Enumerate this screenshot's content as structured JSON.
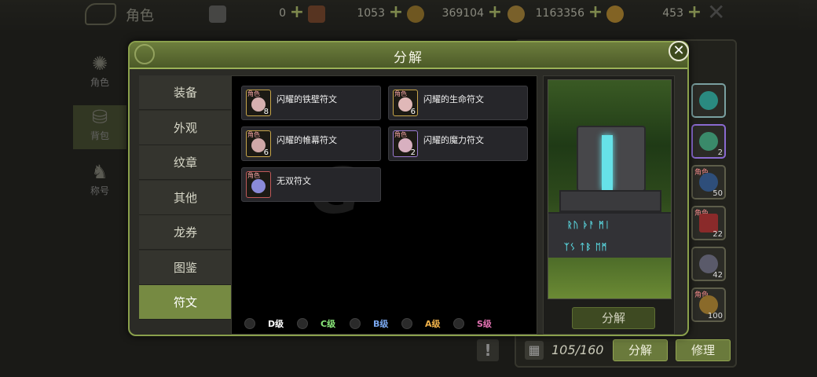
{
  "topbar": {
    "title": "角色",
    "resources": [
      {
        "icon": "card-icon",
        "value": "0"
      },
      {
        "icon": "ticket-icon",
        "value": "1053"
      },
      {
        "icon": "coin-ring-icon",
        "value": "369104"
      },
      {
        "icon": "gold-bag-icon",
        "value": "1163356"
      },
      {
        "icon": "gem-icon",
        "value": "453"
      }
    ]
  },
  "background_nav": [
    {
      "label": "角色",
      "icon": "character-icon"
    },
    {
      "label": "背包",
      "icon": "backpack-icon"
    },
    {
      "label": "称号",
      "icon": "title-icon"
    }
  ],
  "right_panel": {
    "slots": [
      {
        "category": "",
        "count": "",
        "color": "#2a8a80"
      },
      {
        "category": "",
        "count": "2",
        "color": "#3a8a6a"
      },
      {
        "category": "角色",
        "count": "50",
        "color": "#2e4e7a"
      },
      {
        "category": "角色",
        "count": "22",
        "color": "#8a2a2a"
      },
      {
        "category": "",
        "count": "42",
        "color": "#5a5a6a"
      },
      {
        "category": "角色",
        "count": "100",
        "color": "#8a6a2a"
      }
    ],
    "capacity": "105/160",
    "decompose_label": "分解",
    "repair_label": "修理",
    "alert_label": "!"
  },
  "modal": {
    "title": "分解",
    "close_label": "✕",
    "tabs": [
      {
        "label": "装备",
        "active": false
      },
      {
        "label": "外观",
        "active": false
      },
      {
        "label": "纹章",
        "active": false
      },
      {
        "label": "其他",
        "active": false
      },
      {
        "label": "龙券",
        "active": false
      },
      {
        "label": "图鉴",
        "active": false
      },
      {
        "label": "符文",
        "active": true
      }
    ],
    "items": [
      {
        "name": "闪耀的铁壁符文",
        "category": "角色",
        "count": "8",
        "border": "#c8a64a",
        "rune_color": "#d6b0b0"
      },
      {
        "name": "闪耀的生命符文",
        "category": "角色",
        "count": "6",
        "border": "#c8a64a",
        "rune_color": "#e0b8b8"
      },
      {
        "name": "闪耀的帷幕符文",
        "category": "角色",
        "count": "6",
        "border": "#c8a64a",
        "rune_color": "#d0a8a8"
      },
      {
        "name": "闪耀的魔力符文",
        "category": "角色",
        "count": "2",
        "border": "#9a7ad0",
        "rune_color": "#d8b0c0"
      },
      {
        "name": "无双符文",
        "category": "角色",
        "count": "",
        "border": "#c05a5a",
        "rune_color": "#8a8ad8"
      }
    ],
    "grades": [
      {
        "label": "D级",
        "color": "#ffffff"
      },
      {
        "label": "C级",
        "color": "#8ae87a"
      },
      {
        "label": "B级",
        "color": "#7aa8f0"
      },
      {
        "label": "A级",
        "color": "#f0b24a"
      },
      {
        "label": "S级",
        "color": "#e070b0"
      }
    ],
    "preview_decompose_label": "分解"
  }
}
